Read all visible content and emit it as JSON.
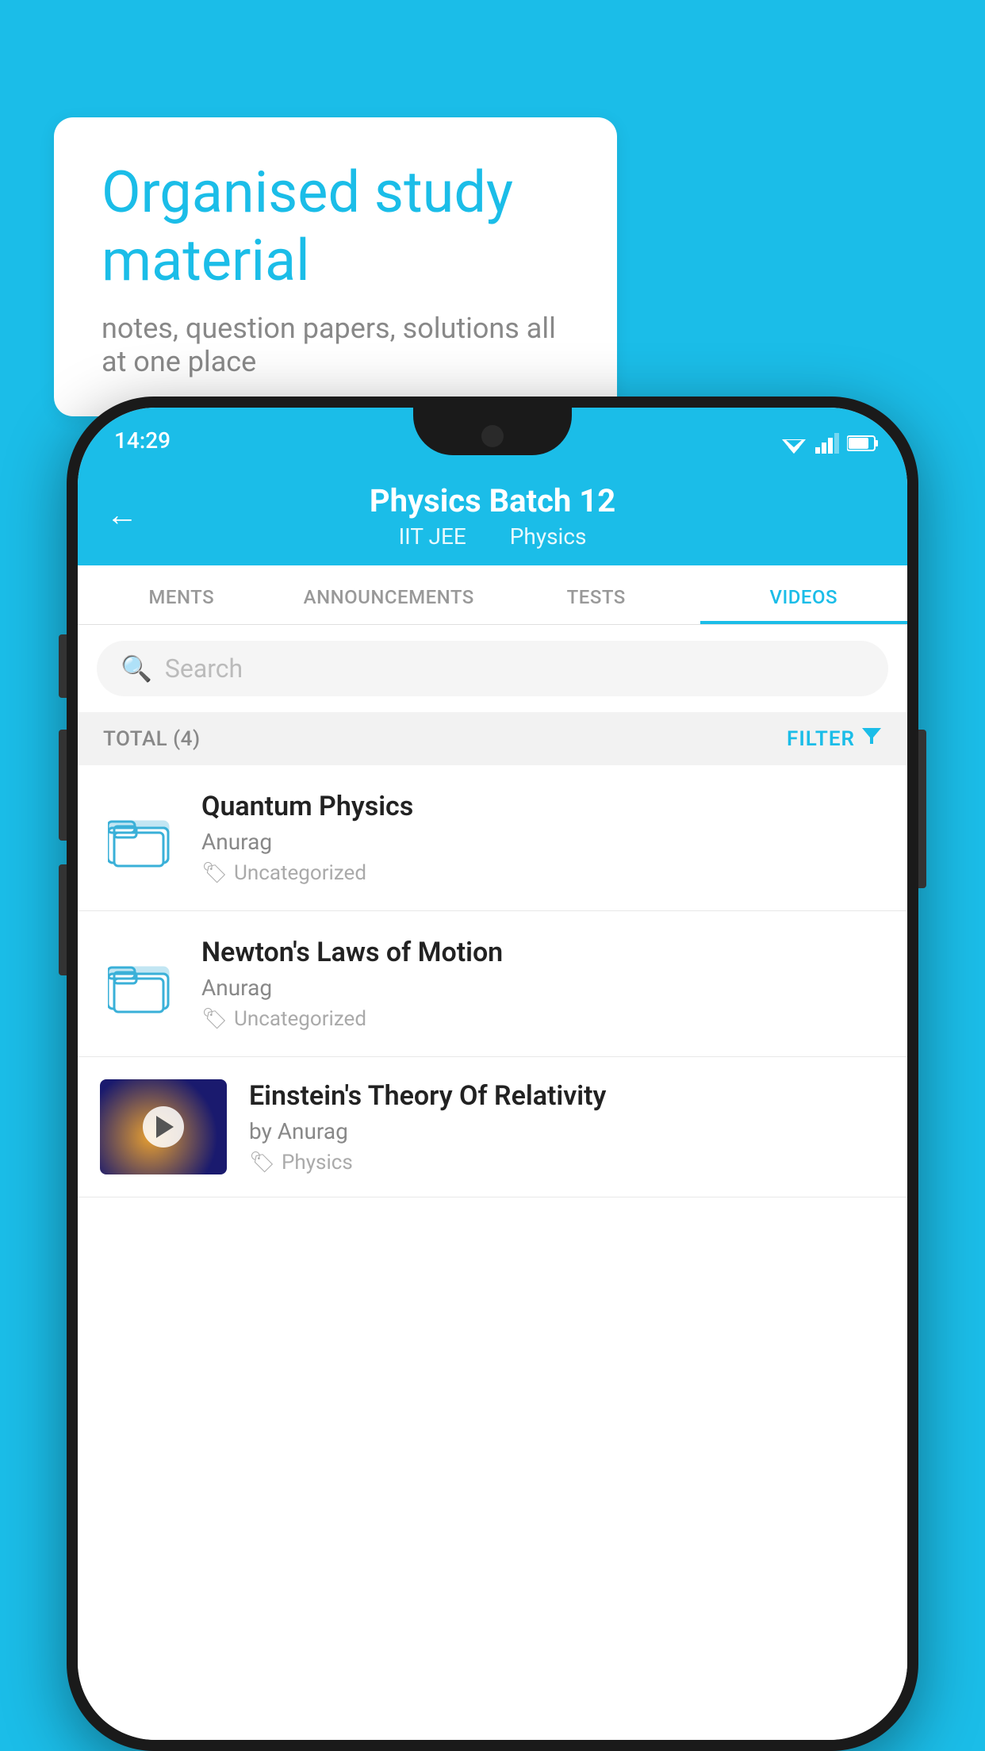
{
  "background_color": "#1BBDE8",
  "speech_bubble": {
    "title": "Organised study material",
    "subtitle": "notes, question papers, solutions all at one place"
  },
  "status_bar": {
    "time": "14:29"
  },
  "header": {
    "title": "Physics Batch 12",
    "subtitle_left": "IIT JEE",
    "subtitle_right": "Physics",
    "back_label": "←"
  },
  "tabs": [
    {
      "label": "MENTS",
      "active": false
    },
    {
      "label": "ANNOUNCEMENTS",
      "active": false
    },
    {
      "label": "TESTS",
      "active": false
    },
    {
      "label": "VIDEOS",
      "active": true
    }
  ],
  "search": {
    "placeholder": "Search"
  },
  "filter_bar": {
    "total_label": "TOTAL (4)",
    "filter_label": "FILTER"
  },
  "videos": [
    {
      "id": 1,
      "title": "Quantum Physics",
      "author": "Anurag",
      "tag": "Uncategorized",
      "has_thumbnail": false
    },
    {
      "id": 2,
      "title": "Newton's Laws of Motion",
      "author": "Anurag",
      "tag": "Uncategorized",
      "has_thumbnail": false
    },
    {
      "id": 3,
      "title": "Einstein's Theory Of Relativity",
      "author": "by Anurag",
      "tag": "Physics",
      "has_thumbnail": true
    }
  ]
}
